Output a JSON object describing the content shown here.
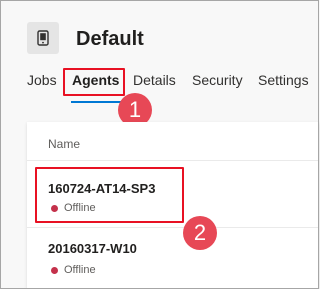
{
  "pool": {
    "icon": "agent-pool-icon",
    "title": "Default"
  },
  "tabs": [
    {
      "label": "Jobs",
      "active": false
    },
    {
      "label": "Agents",
      "active": true
    },
    {
      "label": "Details",
      "active": false
    },
    {
      "label": "Security",
      "active": false
    },
    {
      "label": "Settings",
      "active": false
    }
  ],
  "callouts": [
    "1",
    "2"
  ],
  "agents_table": {
    "column_header": "Name",
    "rows": [
      {
        "name": "160724-AT14-SP3",
        "status": "Offline"
      },
      {
        "name": "20160317-W10",
        "status": "Offline"
      }
    ]
  },
  "colors": {
    "accent": "#0078d4",
    "highlight": "#e81123",
    "callout": "#e74856",
    "offline": "#c4314b"
  }
}
